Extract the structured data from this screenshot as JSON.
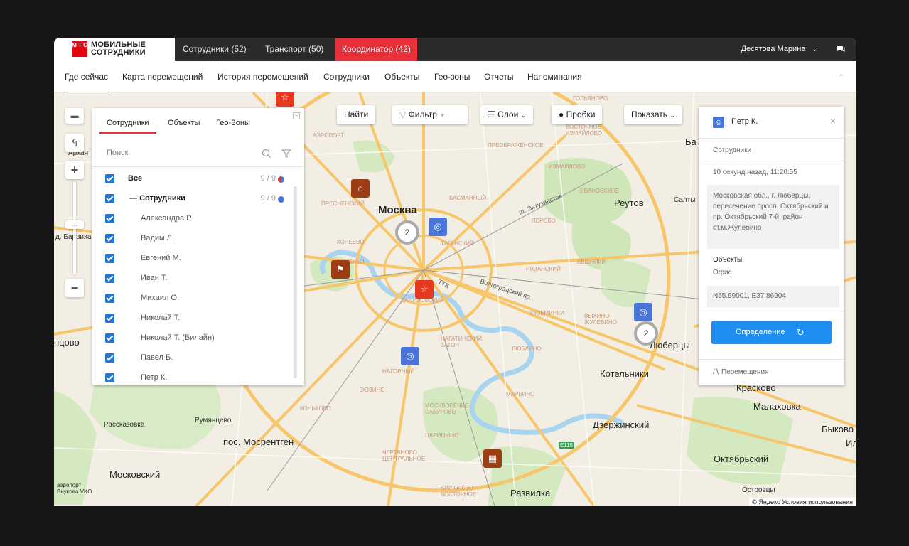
{
  "app": {
    "logo_line1": "МОБИЛЬНЫЕ",
    "logo_line2": "СОТРУДНИКИ",
    "logo_mark": "М Т С",
    "top_tabs": [
      "Сотрудники (52)",
      "Транспорт (50)",
      "Координатор (42)"
    ],
    "user_name": "Десятова Марина",
    "accent_color": "#e8303a"
  },
  "subnav": {
    "items": [
      "Где сейчас",
      "Карта перемещений",
      "История перемещений",
      "Сотрудники",
      "Объекты",
      "Гео-зоны",
      "Отчеты",
      "Напоминания"
    ],
    "active_index": 0
  },
  "map_toolbar": {
    "find": "Найти",
    "filter": "Фильтр",
    "layers": "Слои",
    "traffic": "Пробки",
    "show": "Показать"
  },
  "sidebar": {
    "tabs": [
      "Сотрудники",
      "Объекты",
      "Гео-Зоны"
    ],
    "search_placeholder": "Поиск",
    "all_label": "Все",
    "all_count": "9 / 9",
    "group_label": "Сотрудники",
    "group_count": "9 / 9",
    "employees": [
      "Александра Р.",
      "Вадим Л.",
      "Евгений М.",
      "Иван Т.",
      "Михаил О.",
      "Николай Т.",
      "Николай Т. (Билайн)",
      "Павел Б.",
      "Петр К."
    ]
  },
  "info_card": {
    "name": "Петр К.",
    "category": "Сотрудники",
    "time": "10 секунд назад, 11:20:55",
    "address": "Московская обл., г. Люберцы, пересечение просп. Октябрьский и пр. Октябрьский 7-й, район ст.м.Жулебино",
    "objects_label": "Объекты:",
    "objects_value": "Офис",
    "coordinates": "N55.69001, E37.86904",
    "detect_button": "Определение",
    "movements": "Перемещения"
  },
  "map": {
    "clusters": [
      "2",
      "2"
    ],
    "labels": {
      "moscow": "Москва",
      "reutov": "Реутов",
      "kotelniki": "Котельники",
      "lyubertsy": "Люберцы",
      "kraskovo": "Красково",
      "malakhovka": "Малаховка",
      "dzerzhinsky": "Дзержинский",
      "oktyabrsky": "Октябрьский",
      "mosrentgen": "пос. Мосрентген",
      "moskovsky": "Московский",
      "razvilka": "Развилка",
      "rumyantsevo": "Румянцево",
      "rasskazovka": "Рассказовка",
      "odintsovo": "нцово",
      "saltykovka": "Салты",
      "ba": "Ба",
      "barvikha": "д. Барвиха",
      "arkh": "Архан",
      "kraskovo_small": "Лай",
      "ostrovtsy": "Островцы",
      "bykovo": "Быково",
      "il": "Ил",
      "e115": "E115",
      "vnukovo": "аэропорт Внуково VKO",
      "izmaylovo": "ИЗМАЙЛОВО",
      "perovo": "ПЕРОВО",
      "ryazansky": "РЯЗАНСКИЙ",
      "kuzminki": "КУЗЬМИНКИ",
      "vykhino": "ВЫХИНО-ЖУЛЕБИНО",
      "lyublino": "ЛЮБЛИНО",
      "maryino": "МАРЬИНО",
      "nagatinsky": "НАГАТИНСКИЙ ЗАТОН",
      "danilovsky": "ДАНИЛОВСКИЙ",
      "zyuzino": "ЗЮЗИНО",
      "konkovo": "КОНЬКОВО",
      "chertanovo": "ЧЕРТАНОВО ЦЕНТРАЛЬНОЕ",
      "biryulyovo": "БИРЮЛЁВО ВОСТОЧНОЕ",
      "tsaritsyno": "ЦАРИЦЫНО",
      "moskvorechye": "МОСКВОРЕЧЬЕ-САБУРОВО",
      "nagorny": "НАГОРНЫЙ",
      "presnensky": "ПРЕСНЕНСКИЙ",
      "basmanny": "БАСМАННЫЙ",
      "tagansky": "ТАГАНСКИЙ",
      "ramenki": "РАМЕНКИ",
      "golyanovo": "ГОЛЬЯНОВО",
      "preobrazhenskoe": "ПРЕОБРАЖЕНСКОЕ",
      "izmaylovo_east": "ВОСТОЧНОЕ ИЗМАЙЛОВО",
      "ivanovskoe": "ИВАНОВСКОЕ",
      "veshnyaki": "ВЕШНЯКИ",
      "aeroport": "АЭРОПОРТ",
      "khoroshevo": "ХОРОШЁВО-МНЁВНИКИ",
      "ramenki2": "КОНЕЕВО",
      "ttk": "ТТК",
      "volgogradsky": "Волгоградский пр.",
      "entuziastov": "ш. Энтузиастов"
    },
    "copyright": "© Яндекс Условия использования"
  }
}
